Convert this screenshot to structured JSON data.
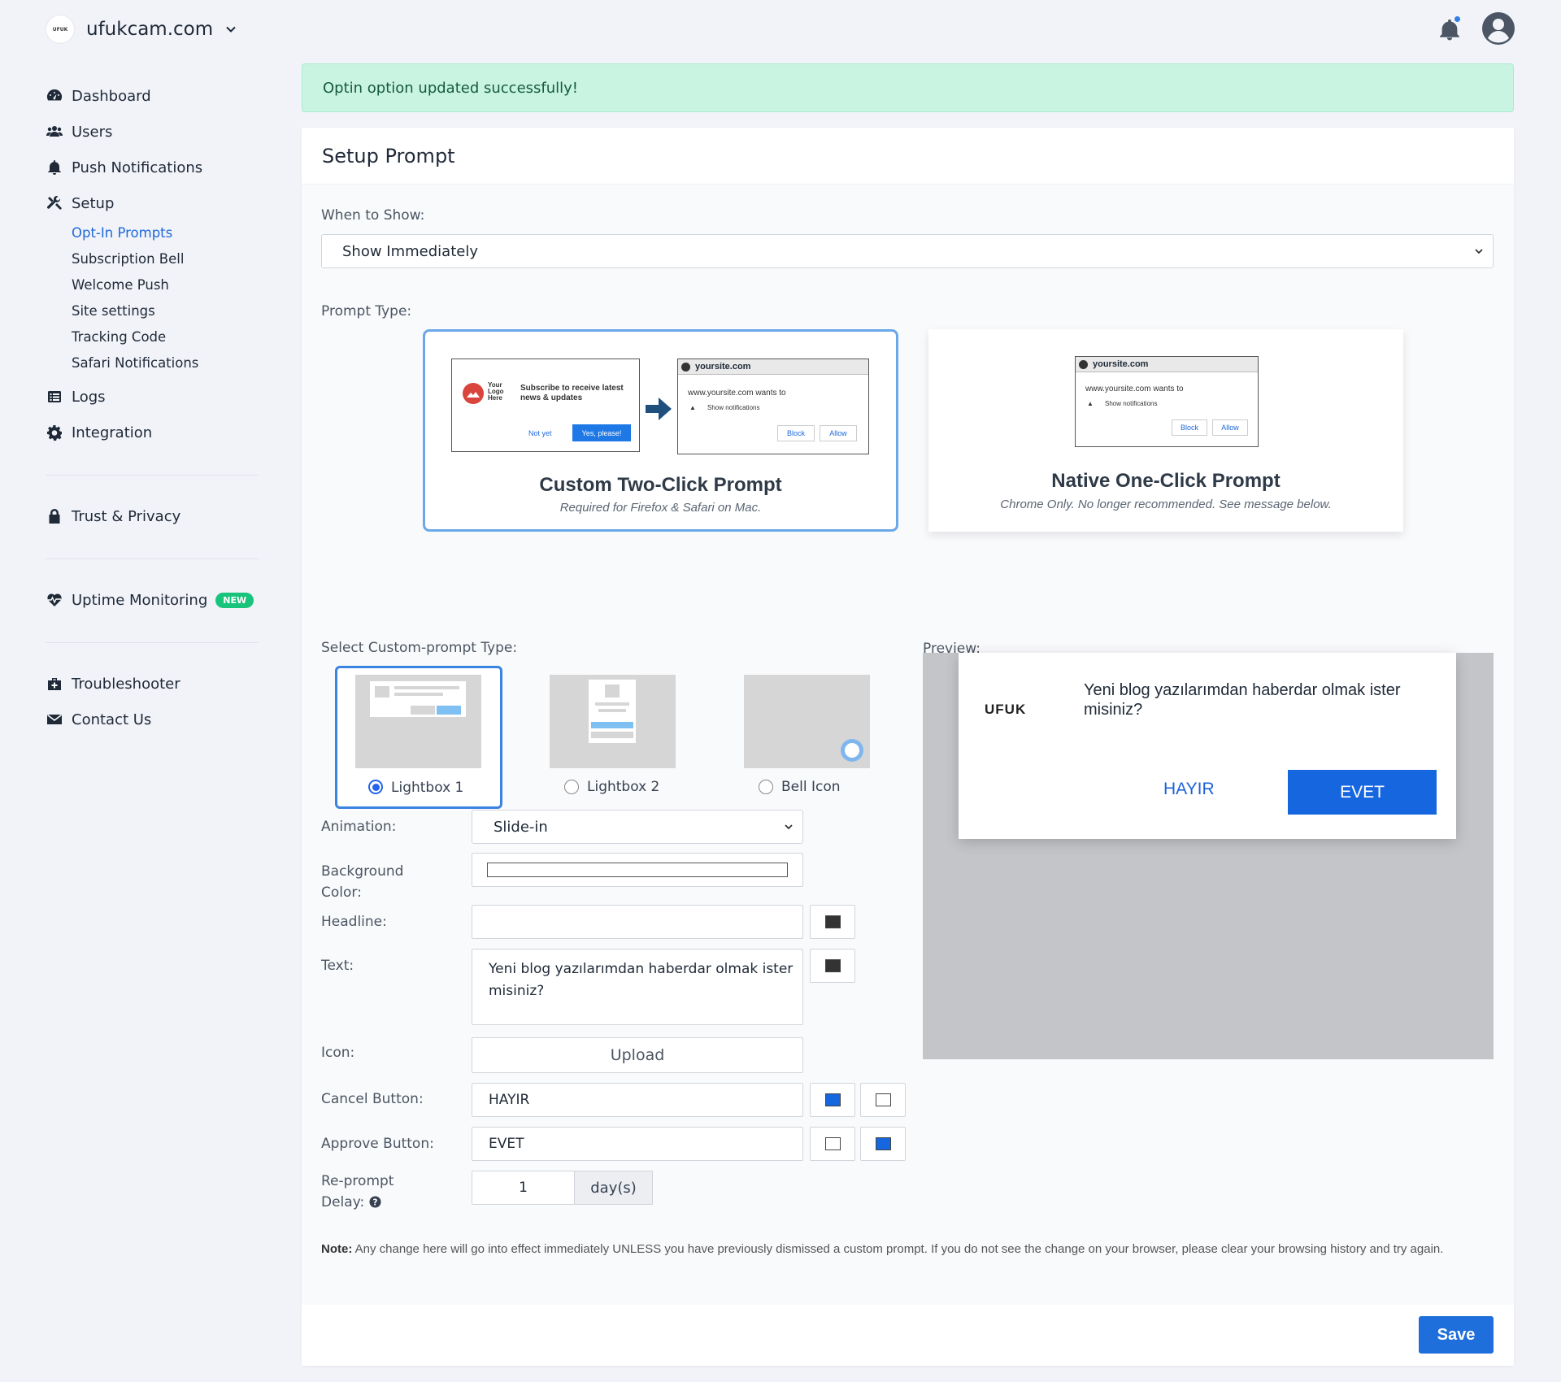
{
  "topbar": {
    "site_logo_text": "UFUK",
    "site_name": "ufukcam.com"
  },
  "sidebar": {
    "items": [
      {
        "label": "Dashboard",
        "icon": "gauge-icon"
      },
      {
        "label": "Users",
        "icon": "users-icon"
      },
      {
        "label": "Push Notifications",
        "icon": "bell-icon"
      },
      {
        "label": "Setup",
        "icon": "tools-icon"
      }
    ],
    "setup_subitems": [
      {
        "label": "Opt-In Prompts",
        "active": true
      },
      {
        "label": "Subscription Bell"
      },
      {
        "label": "Welcome Push"
      },
      {
        "label": "Site settings"
      },
      {
        "label": "Tracking Code"
      },
      {
        "label": "Safari Notifications"
      }
    ],
    "logs": "Logs",
    "integration": "Integration",
    "trust_privacy": "Trust & Privacy",
    "uptime_monitoring": "Uptime Monitoring",
    "new_badge": "NEW",
    "troubleshooter": "Troubleshooter",
    "contact_us": "Contact Us"
  },
  "alert": {
    "message": "Optin option updated successfully!"
  },
  "card": {
    "title": "Setup Prompt",
    "when_to_show_label": "When to Show:",
    "when_to_show_value": "Show Immediately",
    "prompt_type_label": "Prompt Type:",
    "prompt_types": [
      {
        "title": "Custom Two-Click Prompt",
        "subtitle": "Required for Firefox & Safari on Mac.",
        "selected": true,
        "mock_custom": {
          "logo": "Your Logo Here",
          "text": "Subscribe to receive latest news & updates",
          "not_yet": "Not yet",
          "yes": "Yes, please!"
        },
        "mock_native": {
          "domain": "yoursite.com",
          "wants": "www.yoursite.com wants to",
          "show": "Show notifications",
          "block": "Block",
          "allow": "Allow"
        }
      },
      {
        "title": "Native One-Click Prompt",
        "subtitle": "Chrome Only. No longer recommended. See message below.",
        "selected": false,
        "mock_native": {
          "domain": "yoursite.com",
          "wants": "www.yoursite.com wants to",
          "show": "Show notifications",
          "block": "Block",
          "allow": "Allow"
        }
      }
    ],
    "custom_prompt_type_label": "Select Custom-prompt Type:",
    "custom_prompt_types": [
      {
        "label": "Lightbox 1",
        "selected": true
      },
      {
        "label": "Lightbox 2",
        "selected": false
      },
      {
        "label": "Bell Icon",
        "selected": false
      }
    ],
    "preview_label": "Preview:",
    "form": {
      "animation_label": "Animation:",
      "animation_value": "Slide-in",
      "bg_color_label": "Background Color:",
      "headline_label": "Headline:",
      "headline_value": "",
      "text_label": "Text:",
      "text_value": "Yeni blog yazılarımdan haberdar olmak ister misiniz?",
      "icon_label": "Icon:",
      "upload_label": "Upload",
      "cancel_label": "Cancel Button:",
      "cancel_value": "HAYIR",
      "approve_label": "Approve Button:",
      "approve_value": "EVET",
      "reprompt_label": "Re-prompt Delay:",
      "reprompt_value": "1",
      "reprompt_unit": "day(s)"
    },
    "colors": {
      "headline_text": "#333333",
      "text_color": "#333333",
      "cancel_text": "#1666e0",
      "cancel_bg": "#ffffff",
      "approve_text": "#ffffff",
      "approve_bg": "#1666e0"
    },
    "preview": {
      "logo": "UFUK",
      "text": "Yeni blog yazılarımdan haberdar olmak ister misiniz?",
      "cancel": "HAYIR",
      "approve": "EVET"
    },
    "note_label": "Note:",
    "note_text": "Any change here will go into effect immediately UNLESS you have previously dismissed a custom prompt. If you do not see the change on your browser, please clear your browsing history and try again.",
    "save_label": "Save"
  }
}
